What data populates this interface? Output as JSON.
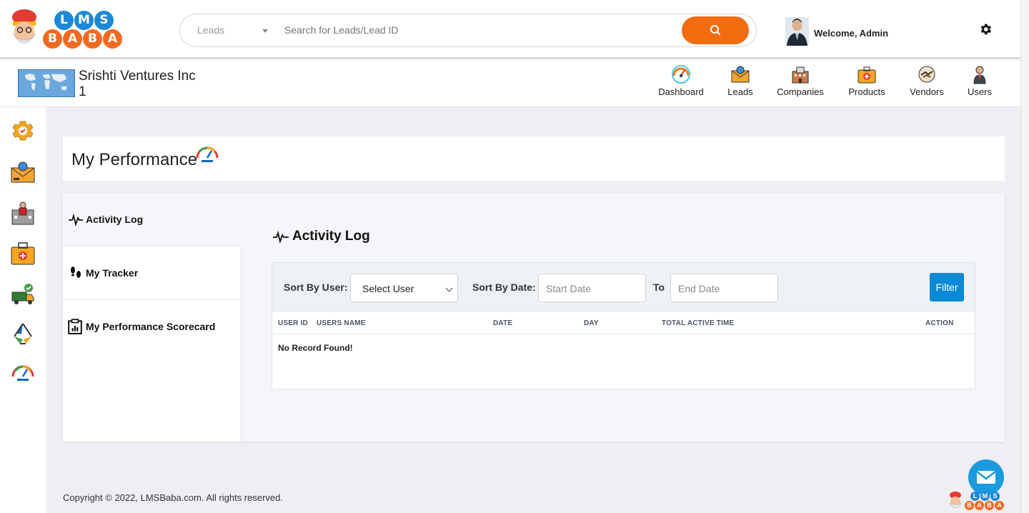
{
  "brand": {
    "logo_top": [
      "L",
      "M",
      "S"
    ],
    "logo_bottom": [
      "B",
      "A",
      "B",
      "A"
    ]
  },
  "search": {
    "category": "Leads",
    "placeholder": "Search for Leads/Lead ID",
    "button_icon": "search-icon"
  },
  "user": {
    "welcome": "Welcome, Admin",
    "settings_icon": "gear-icon"
  },
  "company": {
    "name": "Srishti Ventures Inc 1"
  },
  "nav": [
    {
      "label": "Dashboard",
      "icon": "speedometer-icon"
    },
    {
      "label": "Leads",
      "icon": "envelope-icon"
    },
    {
      "label": "Companies",
      "icon": "building-icon"
    },
    {
      "label": "Products",
      "icon": "briefcase-icon"
    },
    {
      "label": "Vendors",
      "icon": "handshake-icon"
    },
    {
      "label": "Users",
      "icon": "user-icon"
    }
  ],
  "rail": [
    "settings-gear-icon",
    "leads-envelope-icon",
    "companies-building-icon",
    "products-briefcase-icon",
    "vendors-truck-icon",
    "recycle-icon",
    "performance-gauge-icon"
  ],
  "page": {
    "title": "My Performance"
  },
  "tabs": [
    {
      "label": "Activity Log",
      "icon": "pulse-icon",
      "active": true
    },
    {
      "label": "My Tracker",
      "icon": "footprints-icon",
      "active": false
    },
    {
      "label": "My Performance Scorecard",
      "icon": "clipboard-chart-icon",
      "active": false
    }
  ],
  "activity": {
    "heading": "Activity Log",
    "sort_user_label": "Sort By User:",
    "select_user": "Select User",
    "sort_date_label": "Sort By Date:",
    "start_date": "Start Date",
    "to_label": "To",
    "end_date": "End Date",
    "filter_button": "Filter",
    "columns": [
      "USER ID",
      "USERS NAME",
      "DATE",
      "DAY",
      "TOTAL ACTIVE TIME",
      "ACTION"
    ],
    "empty_message": "No Record Found!"
  },
  "footer": {
    "copyright": "Copyright © 2022, LMSBaba.com. All rights reserved."
  },
  "colors": {
    "accent_orange": "#f46c10",
    "accent_blue": "#0a8ad6",
    "chat_blue": "#1a9be0"
  }
}
